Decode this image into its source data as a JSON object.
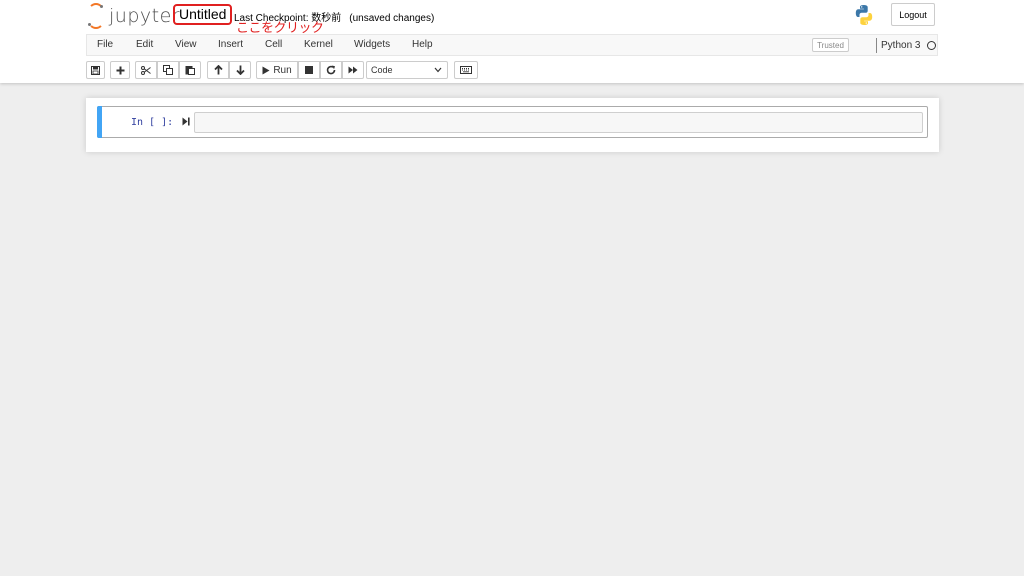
{
  "app": {
    "logo_text": "jupyter",
    "notebook_name": "Untitled",
    "checkpoint_label": "Last Checkpoint: 数秒前",
    "save_status": "(unsaved changes)",
    "annotation": "ここをクリック",
    "logout_label": "Logout",
    "accent_color": "#f37726",
    "annotation_color": "#e02020"
  },
  "menu": {
    "items": [
      "File",
      "Edit",
      "View",
      "Insert",
      "Cell",
      "Kernel",
      "Widgets",
      "Help"
    ],
    "trusted_label": "Trusted",
    "kernel_name": "Python 3",
    "kernel_status_icon": "circle-outline-icon"
  },
  "toolbar": {
    "buttons": [
      "save-icon",
      "plus-icon",
      "cut-icon",
      "copy-icon",
      "paste-icon",
      "arrow-up-icon",
      "arrow-down-icon",
      "play-icon",
      "stop-icon",
      "restart-icon",
      "fast-forward-icon",
      "keyboard-icon"
    ],
    "run_label": "Run",
    "cell_type": "Code"
  },
  "cell": {
    "prompt": "In [ ]:",
    "source": "",
    "active_bar_color": "#42a5f5"
  }
}
